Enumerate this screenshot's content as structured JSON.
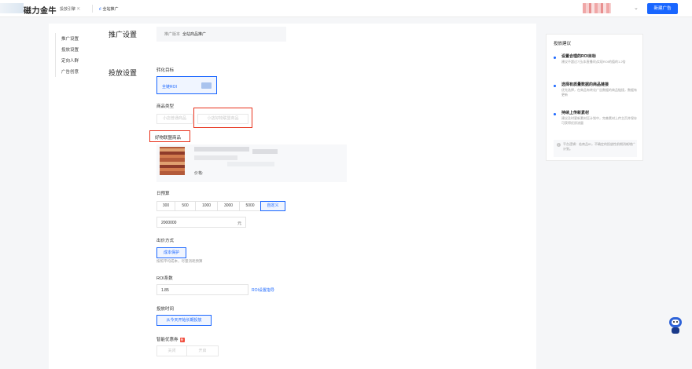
{
  "header": {
    "brand": "磁力金牛",
    "account": "投放引擎",
    "account_ext": "⇱",
    "nav_promo_icon": "chart-icon",
    "nav_promo": "全站推广",
    "user_chevron": "⌄",
    "new_button": "新建广告"
  },
  "sidebar": {
    "items": [
      {
        "label": "推广设置"
      },
      {
        "label": "投放设置"
      },
      {
        "label": "定向人群"
      },
      {
        "label": "广告创意"
      }
    ]
  },
  "promo_settings": {
    "title": "推广设置",
    "field_label": "推广版本",
    "field_value": "全站商品推广"
  },
  "delivery": {
    "title": "投放设置",
    "conversion_goal_label": "转化目标",
    "conversion_goal_value": "全链ROI",
    "product_type_label": "商品类型",
    "product_type_options": [
      "小店普通商品",
      "小店好物联盟商品"
    ],
    "selected_product_label": "好物联盟商品",
    "price_label": "价格:",
    "budget_label": "日预算",
    "budget_options": [
      "300",
      "500",
      "1000",
      "3000",
      "5000",
      "自定义"
    ],
    "budget_active": "自定义",
    "budget_value": "2000000",
    "budget_unit": "元",
    "bid_label": "出价方式",
    "bid_value": "成本保护",
    "bid_hint": "按照平均成本，尽量消耗预算",
    "roi_label": "ROI系数",
    "roi_value": "1.85",
    "roi_link": "ROI设置指导",
    "time_label": "投放时间",
    "time_value": "从今天开始长期投放",
    "coupon_label": "智能优惠券",
    "coupon_badge": "新",
    "coupon_options": [
      "关闭",
      "开启"
    ]
  },
  "tips": {
    "title": "投放建议",
    "items": [
      {
        "heading": "设置合理的ROI目标",
        "desc": "建议不超过7日(本直播间)实现ROI的值的1.2倍"
      },
      {
        "heading": "选择有质量数据的商品链接",
        "desc": "优先选择，在商品有转化广告数据的商品链接，数据有更新"
      },
      {
        "heading": "持续上传新素材",
        "desc": "建议及时更新素材至计划中，完善素材上传主页并保存可获得优质流量"
      }
    ],
    "footer": "平台逻辑：若商品ID，不确定的投放性前期消耗增广计划。"
  },
  "assistant": {
    "icon": "assistant-bot-icon"
  },
  "colors": {
    "primary": "#1966ff",
    "highlight": "#e8321c"
  }
}
